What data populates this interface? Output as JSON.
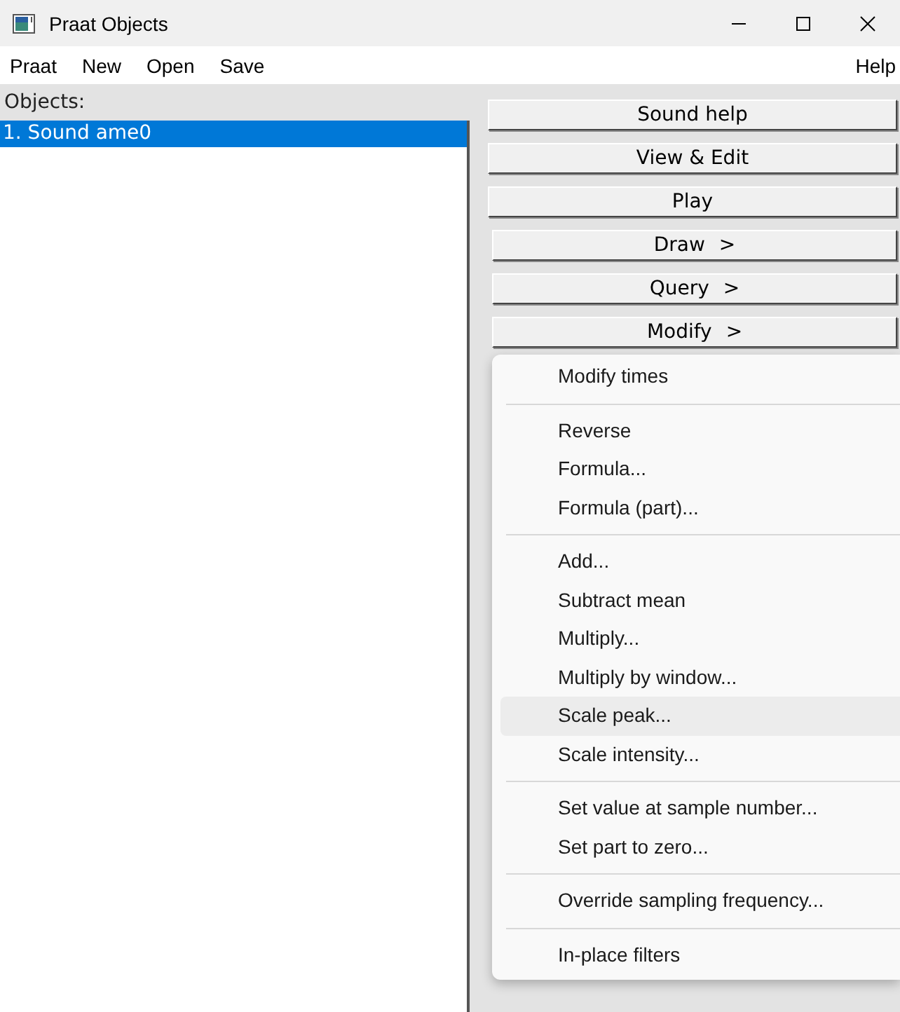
{
  "window": {
    "title": "Praat Objects"
  },
  "menu_bar": {
    "left": [
      "Praat",
      "New",
      "Open",
      "Save"
    ],
    "right": [
      "Help"
    ]
  },
  "objects": {
    "label": "Objects:",
    "items": [
      {
        "text": "1. Sound ame0",
        "selected": true
      }
    ]
  },
  "buttons": [
    {
      "label": "Sound help",
      "kind": "button"
    },
    {
      "label": "View & Edit",
      "kind": "button"
    },
    {
      "label": "Play",
      "kind": "button"
    },
    {
      "label": "Draw",
      "kind": "submenu",
      "arrow": ">"
    },
    {
      "label": "Query",
      "kind": "submenu",
      "arrow": ">"
    },
    {
      "label": "Modify",
      "kind": "submenu",
      "arrow": ">"
    }
  ],
  "popup_menu": {
    "items": [
      {
        "kind": "item",
        "label": "Modify times",
        "highlighted": false
      },
      {
        "kind": "separator"
      },
      {
        "kind": "item",
        "label": "Reverse",
        "highlighted": false
      },
      {
        "kind": "item",
        "label": "Formula...",
        "highlighted": false
      },
      {
        "kind": "item",
        "label": "Formula (part)...",
        "highlighted": false
      },
      {
        "kind": "separator"
      },
      {
        "kind": "item",
        "label": "Add...",
        "highlighted": false
      },
      {
        "kind": "item",
        "label": "Subtract mean",
        "highlighted": false
      },
      {
        "kind": "item",
        "label": "Multiply...",
        "highlighted": false
      },
      {
        "kind": "item",
        "label": "Multiply by window...",
        "highlighted": false
      },
      {
        "kind": "item",
        "label": "Scale peak...",
        "highlighted": true
      },
      {
        "kind": "item",
        "label": "Scale intensity...",
        "highlighted": false
      },
      {
        "kind": "separator"
      },
      {
        "kind": "item",
        "label": "Set value at sample number...",
        "highlighted": false
      },
      {
        "kind": "item",
        "label": "Set part to zero...",
        "highlighted": false
      },
      {
        "kind": "separator"
      },
      {
        "kind": "item",
        "label": "Override sampling frequency...",
        "highlighted": false
      },
      {
        "kind": "separator"
      },
      {
        "kind": "item",
        "label": "In-place filters",
        "highlighted": false
      }
    ]
  }
}
